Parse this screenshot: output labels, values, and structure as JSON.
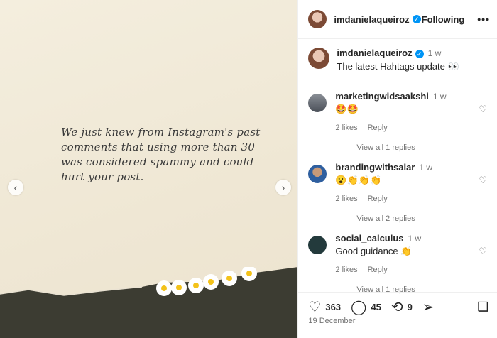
{
  "post": {
    "quote": "We just knew from Instagram's past comments that using more than 30 was considered spammy and could hurt your post."
  },
  "header": {
    "username": "imdanielaqueiroz",
    "follow_label": "Following",
    "more_label": "•••"
  },
  "caption": {
    "username": "imdanielaqueiroz",
    "time": "1 w",
    "text": "The latest Hahtags update 👀"
  },
  "comments": [
    {
      "username": "marketingwidsaakshi",
      "time": "1 w",
      "text": "🤩🤩",
      "likes": "2 likes",
      "reply": "Reply",
      "view_replies": "View all 1 replies"
    },
    {
      "username": "brandingwithsalar",
      "time": "1 w",
      "text": "😮👏👏👏",
      "likes": "2 likes",
      "reply": "Reply",
      "view_replies": "View all 2 replies"
    },
    {
      "username": "social_calculus",
      "time": "1 w",
      "text": "Good guidance 👏",
      "likes": "2 likes",
      "reply": "Reply",
      "view_replies": "View all 1 replies"
    }
  ],
  "actions": {
    "likes": "363",
    "comments": "45",
    "shares": "9"
  },
  "date": "19 December",
  "icons": {
    "heart": "heart-icon",
    "comment": "comment-icon",
    "repost": "repost-icon",
    "share": "share-icon",
    "save": "bookmark-icon"
  }
}
